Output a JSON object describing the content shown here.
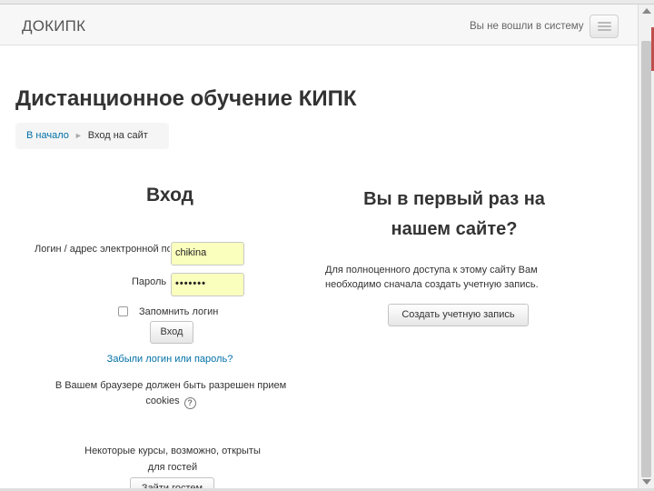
{
  "navbar": {
    "brand": "ДОКИПК",
    "login_status": "Вы не вошли в систему"
  },
  "page": {
    "title": "Дистанционное обучение КИПК"
  },
  "breadcrumb": {
    "home": "В начало",
    "separator": "►",
    "current": "Вход на сайт"
  },
  "login": {
    "heading": "Вход",
    "username_label": "Логин / адрес электронной почты",
    "username_value": "chikina",
    "password_label": "Пароль",
    "password_value": "•••••••",
    "remember_label": "Запомнить логин",
    "submit_label": "Вход",
    "forgot_link": "Забыли логин или пароль?",
    "cookies_line1": "В Вашем браузере должен быть разрешен прием",
    "cookies_line2": "cookies",
    "guest_line1": "Некоторые курсы, возможно, открыты",
    "guest_line2": "для гостей",
    "guest_button": "Зайти гостем"
  },
  "signup": {
    "heading_line1": "Вы в первый раз на",
    "heading_line2": "нашем сайте?",
    "text_line1": "Для полноценного доступа к этому сайту Вам",
    "text_line2": "необходимо сначала создать учетную запись.",
    "button_label": "Создать учетную запись"
  },
  "icons": {
    "help": "help-icon",
    "menu": "menu-icon"
  },
  "colors": {
    "link": "#0070a8",
    "autofill": "#faffbd"
  }
}
